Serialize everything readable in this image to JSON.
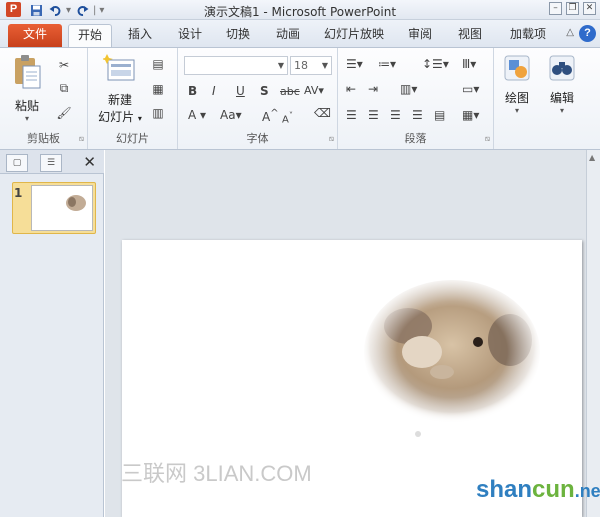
{
  "titlebar": {
    "app_icon_letter": "P",
    "title": "演示文稿1 - Microsoft PowerPoint",
    "qat_items": [
      "save-icon",
      "undo-icon",
      "redo-icon",
      "customize-icon"
    ],
    "controls": [
      "minimize-icon",
      "restore-icon",
      "close-icon"
    ]
  },
  "tabs": {
    "file": "文件",
    "home": "开始",
    "insert": "插入",
    "design": "设计",
    "transitions": "切换",
    "animations": "动画",
    "slideshow": "幻灯片放映",
    "review": "审阅",
    "view": "视图",
    "addins": "加载项"
  },
  "ribbon": {
    "clipboard": {
      "label": "剪贴板",
      "paste": "粘贴"
    },
    "slides": {
      "label": "幻灯片",
      "new_slide_1": "新建",
      "new_slide_2": "幻灯片"
    },
    "font": {
      "label": "字体",
      "font_name": "",
      "font_size": "18"
    },
    "paragraph": {
      "label": "段落"
    },
    "drawing": {
      "label": "绘图"
    },
    "editing": {
      "label": "编辑"
    }
  },
  "pane": {
    "slide_number": "1"
  },
  "colors": {
    "file_tab": "#d24726",
    "thumb_selected": "#f6de98"
  },
  "watermark": {
    "left_text": "三联网 3LIAN.COM",
    "right_a": "shan",
    "right_b": "cun",
    "right_c": ".net"
  }
}
